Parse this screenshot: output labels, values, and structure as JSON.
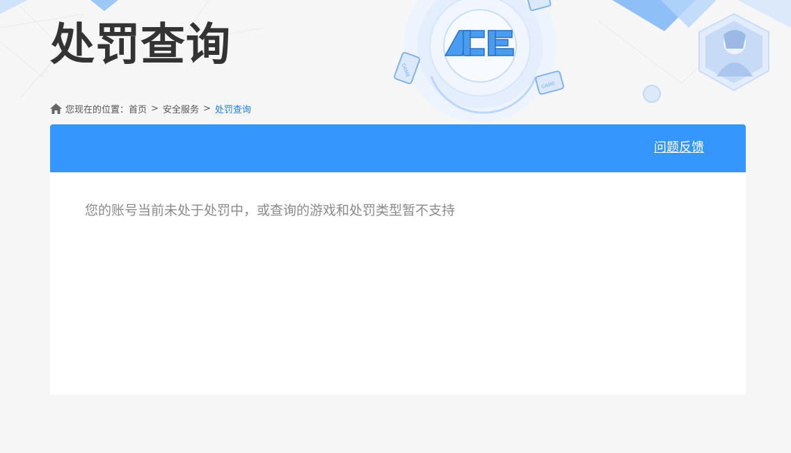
{
  "header": {
    "title": "处罚查询",
    "logo_text": "ACE",
    "game_badges": [
      "GAME",
      "GAME"
    ]
  },
  "breadcrumb": {
    "prefix": "您现在的位置：",
    "items": [
      {
        "label": "首页"
      },
      {
        "label": "安全服务"
      },
      {
        "label": "处罚查询"
      }
    ],
    "separator": ">"
  },
  "panel": {
    "feedback_label": "问题反馈",
    "message": "您的账号当前未处于处罚中，或查询的游戏和处罚类型暂不支持"
  },
  "colors": {
    "accent": "#3597fd",
    "link_current": "#1e7fd6",
    "title": "#333333",
    "page_bg": "#f6f6f6"
  }
}
